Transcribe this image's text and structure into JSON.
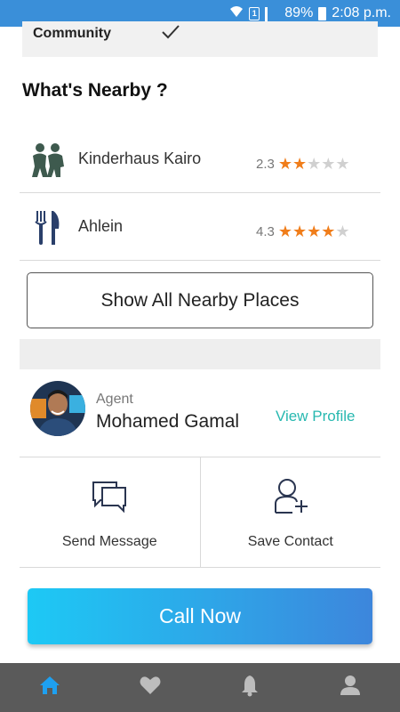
{
  "status_bar": {
    "battery": "89%",
    "time": "2:08 p.m.",
    "sim_label": "1",
    "icons": [
      "wifi-icon",
      "sim-icon",
      "signal-icon",
      "battery-icon"
    ]
  },
  "amenity": {
    "label": "Community",
    "checked": true
  },
  "nearby": {
    "title": "What's Nearby ?",
    "items": [
      {
        "name": "Kinderhaus Kairo",
        "rating": "2.3",
        "stars": 2,
        "icon": "children-icon"
      },
      {
        "name": "Ahlein",
        "rating": "4.3",
        "stars": 4,
        "icon": "restaurant-icon"
      }
    ],
    "show_all_label": "Show All Nearby Places"
  },
  "agent": {
    "role": "Agent",
    "name": "Mohamed Gamal",
    "view_profile_label": "View Profile"
  },
  "actions": {
    "send_message_label": "Send Message",
    "save_contact_label": "Save Contact"
  },
  "call_now_label": "Call Now",
  "bottom_nav": {
    "items": [
      "home-icon",
      "heart-icon",
      "bell-icon",
      "user-icon"
    ],
    "active": "home-icon"
  },
  "colors": {
    "accent": "#27b8b0",
    "star": "#f07d1a",
    "call_gradient_start": "#1dc9f5",
    "call_gradient_end": "#3d86dc",
    "active_nav": "#1ea0f0",
    "nav_bg": "#5a5a5a"
  }
}
